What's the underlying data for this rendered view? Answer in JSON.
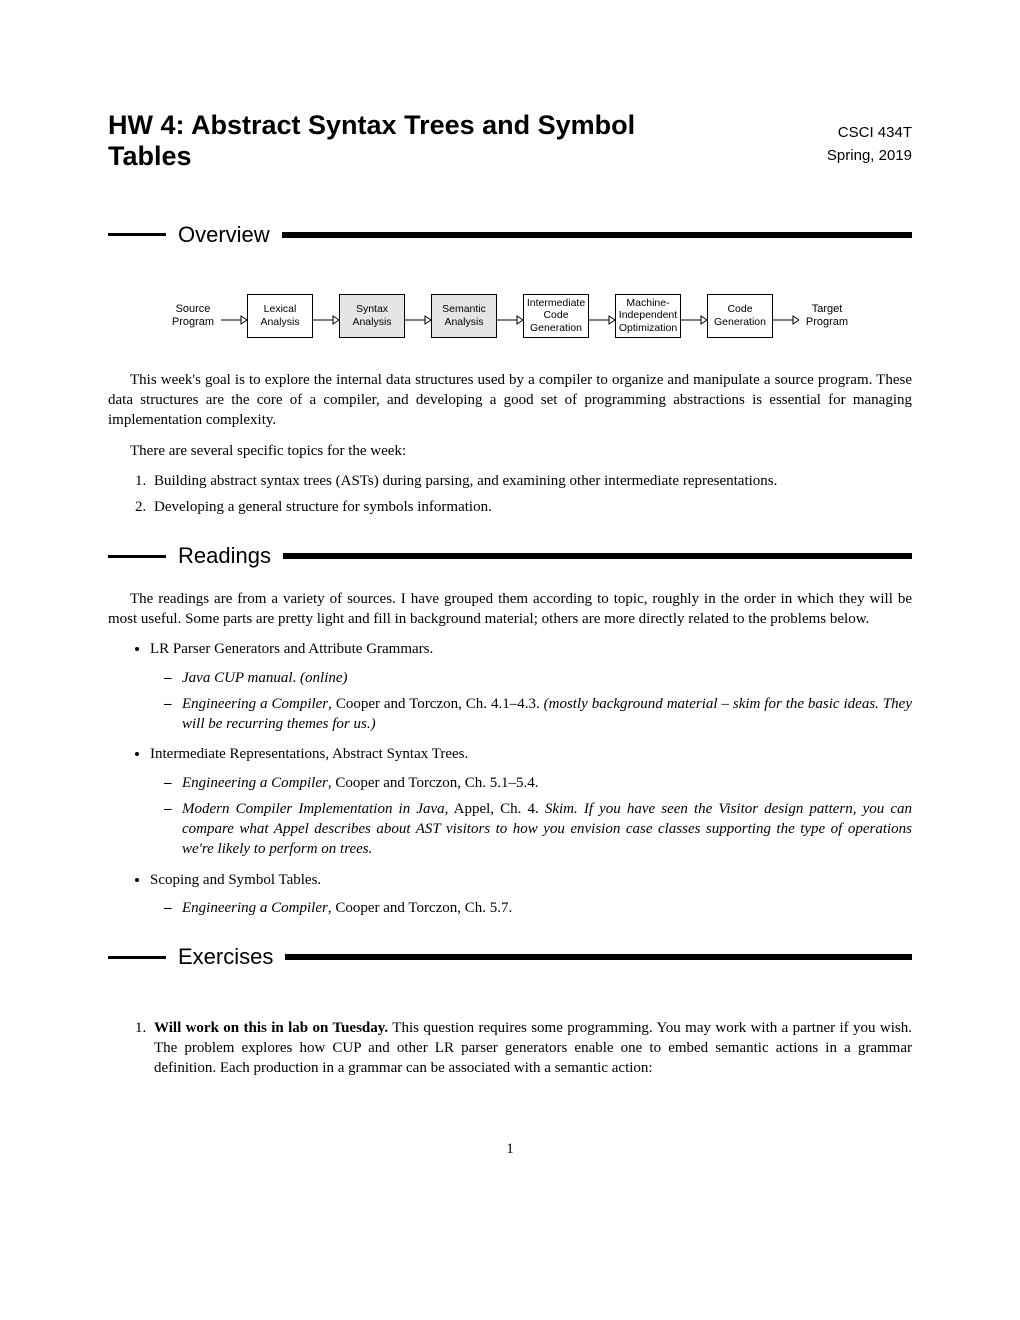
{
  "header": {
    "title": "HW 4: Abstract Syntax Trees and Symbol Tables",
    "course": "CSCI 434T",
    "term": "Spring, 2019"
  },
  "sections": {
    "overview": {
      "title": "Overview"
    },
    "readings": {
      "title": "Readings"
    },
    "exercises": {
      "title": "Exercises"
    }
  },
  "diagram": {
    "nodes": [
      {
        "label": "Source\nProgram",
        "boxed": false,
        "shaded": false
      },
      {
        "label": "Lexical\nAnalysis",
        "boxed": true,
        "shaded": false
      },
      {
        "label": "Syntax\nAnalysis",
        "boxed": true,
        "shaded": true
      },
      {
        "label": "Semantic\nAnalysis",
        "boxed": true,
        "shaded": true
      },
      {
        "label": "Intermediate\nCode\nGeneration",
        "boxed": true,
        "shaded": false
      },
      {
        "label": "Machine-\nIndependent\nOptimization",
        "boxed": true,
        "shaded": false
      },
      {
        "label": "Code\nGeneration",
        "boxed": true,
        "shaded": false
      },
      {
        "label": "Target\nProgram",
        "boxed": false,
        "shaded": false
      }
    ]
  },
  "overview_paras": [
    "This week's goal is to explore the internal data structures used by a compiler to organize and manipulate a source program. These data structures are the core of a compiler, and developing a good set of programming abstractions is essential for managing implementation complexity.",
    "There are several specific topics for the week:"
  ],
  "overview_list": [
    "Building abstract syntax trees (ASTs) during parsing, and examining other intermediate representations.",
    "Developing a general structure for symbols information."
  ],
  "readings_intro": "The readings are from a variety of sources. I have grouped them according to topic, roughly in the order in which they will be most useful. Some parts are pretty light and fill in background material; others are more directly related to the problems below.",
  "readings_groups": [
    {
      "title": "LR Parser Generators and Attribute Grammars.",
      "items": [
        {
          "html": "<i>Java CUP manual</i>. <i>(online)</i>"
        },
        {
          "html": "<i>Engineering a Compiler</i>, Cooper and Torczon, Ch. 4.1–4.3. <i>(mostly background material – skim for the basic ideas. They will be recurring themes for us.)</i>"
        }
      ]
    },
    {
      "title": "Intermediate Representations, Abstract Syntax Trees.",
      "items": [
        {
          "html": "<i>Engineering a Compiler</i>, Cooper and Torczon, Ch. 5.1–5.4."
        },
        {
          "html": "<i>Modern Compiler Implementation in Java</i>, Appel, Ch. 4. <i>Skim. If you have seen the Visitor design pattern, you can compare what Appel describes about AST visitors to how you envision case classes supporting the type of operations we're likely to perform on trees.</i>"
        }
      ]
    },
    {
      "title": "Scoping and Symbol Tables.",
      "items": [
        {
          "html": "<i>Engineering a Compiler</i>, Cooper and Torczon, Ch. 5.7."
        }
      ]
    }
  ],
  "exercises_list": [
    {
      "html": "<b>Will work on this in lab on Tuesday.</b> This question requires some programming. You may work with a partner if you wish. The problem explores how CUP and other LR parser generators enable one to embed semantic actions in a grammar definition. Each production in a grammar can be associated with a semantic action:"
    }
  ],
  "page_number": "1"
}
